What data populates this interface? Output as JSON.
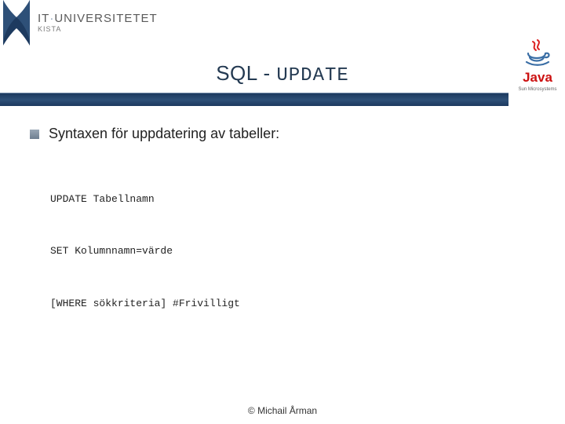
{
  "header": {
    "logo_line1_a": "IT",
    "logo_line1_dot": "·",
    "logo_line1_b": "UNIVERSITETET",
    "logo_line2": "KISTA",
    "java_wordmark": "Java",
    "java_subtext": "Sun Microsystems"
  },
  "title": {
    "prefix": "SQL - ",
    "keyword": "UPDATE"
  },
  "bullet_text": "Syntaxen för uppdatering av tabeller:",
  "code_lines": [
    "UPDATE Tabellnamn",
    "SET Kolumnnamn=värde",
    "[WHERE sökkriteria] #Frivilligt"
  ],
  "footer": "© Michail Årman"
}
